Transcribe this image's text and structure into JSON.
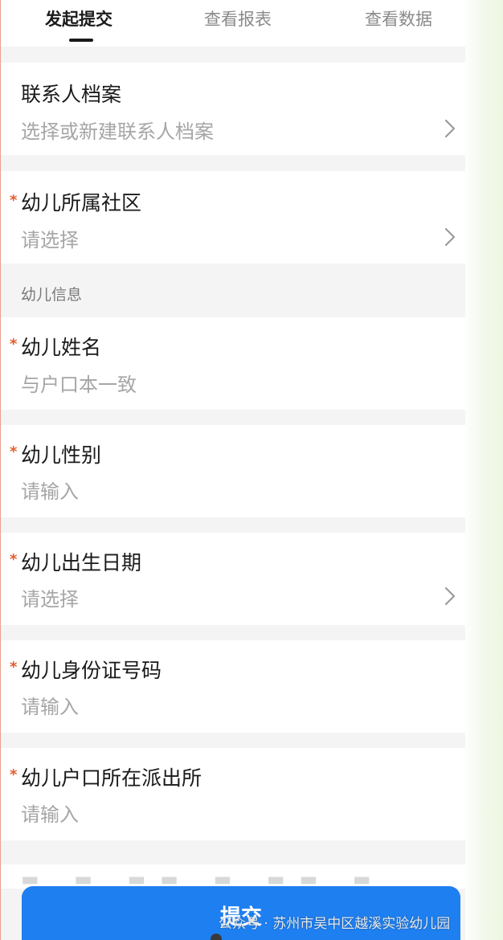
{
  "tabs": [
    {
      "label": "发起提交",
      "active": true
    },
    {
      "label": "查看报表",
      "active": false
    },
    {
      "label": "查看数据",
      "active": false
    }
  ],
  "form": {
    "contact": {
      "label": "联系人档案",
      "placeholder": "选择或新建联系人档案"
    },
    "community": {
      "label": "幼儿所属社区",
      "placeholder": "请选择",
      "required": true
    },
    "section_child_info": "幼儿信息",
    "child_name": {
      "label": "幼儿姓名",
      "placeholder": "与户口本一致",
      "required": true
    },
    "child_gender": {
      "label": "幼儿性别",
      "placeholder": "请输入",
      "required": true
    },
    "child_birthdate": {
      "label": "幼儿出生日期",
      "placeholder": "请选择",
      "required": true
    },
    "child_id_number": {
      "label": "幼儿身份证号码",
      "placeholder": "请输入",
      "required": true
    },
    "child_police_station": {
      "label": "幼儿户口所在派出所",
      "placeholder": "请输入",
      "required": true
    }
  },
  "required_mark": "*",
  "submit_label": "提交",
  "watermark": "公众号 · 苏州市吴中区越溪实验幼儿园",
  "icons": {
    "chevron": "chevron-right-icon",
    "watermark_logo": "wechat-icon"
  },
  "colors": {
    "accent": "#1e7ff0",
    "required": "#e45b2d",
    "background": "#f4f4f5"
  }
}
